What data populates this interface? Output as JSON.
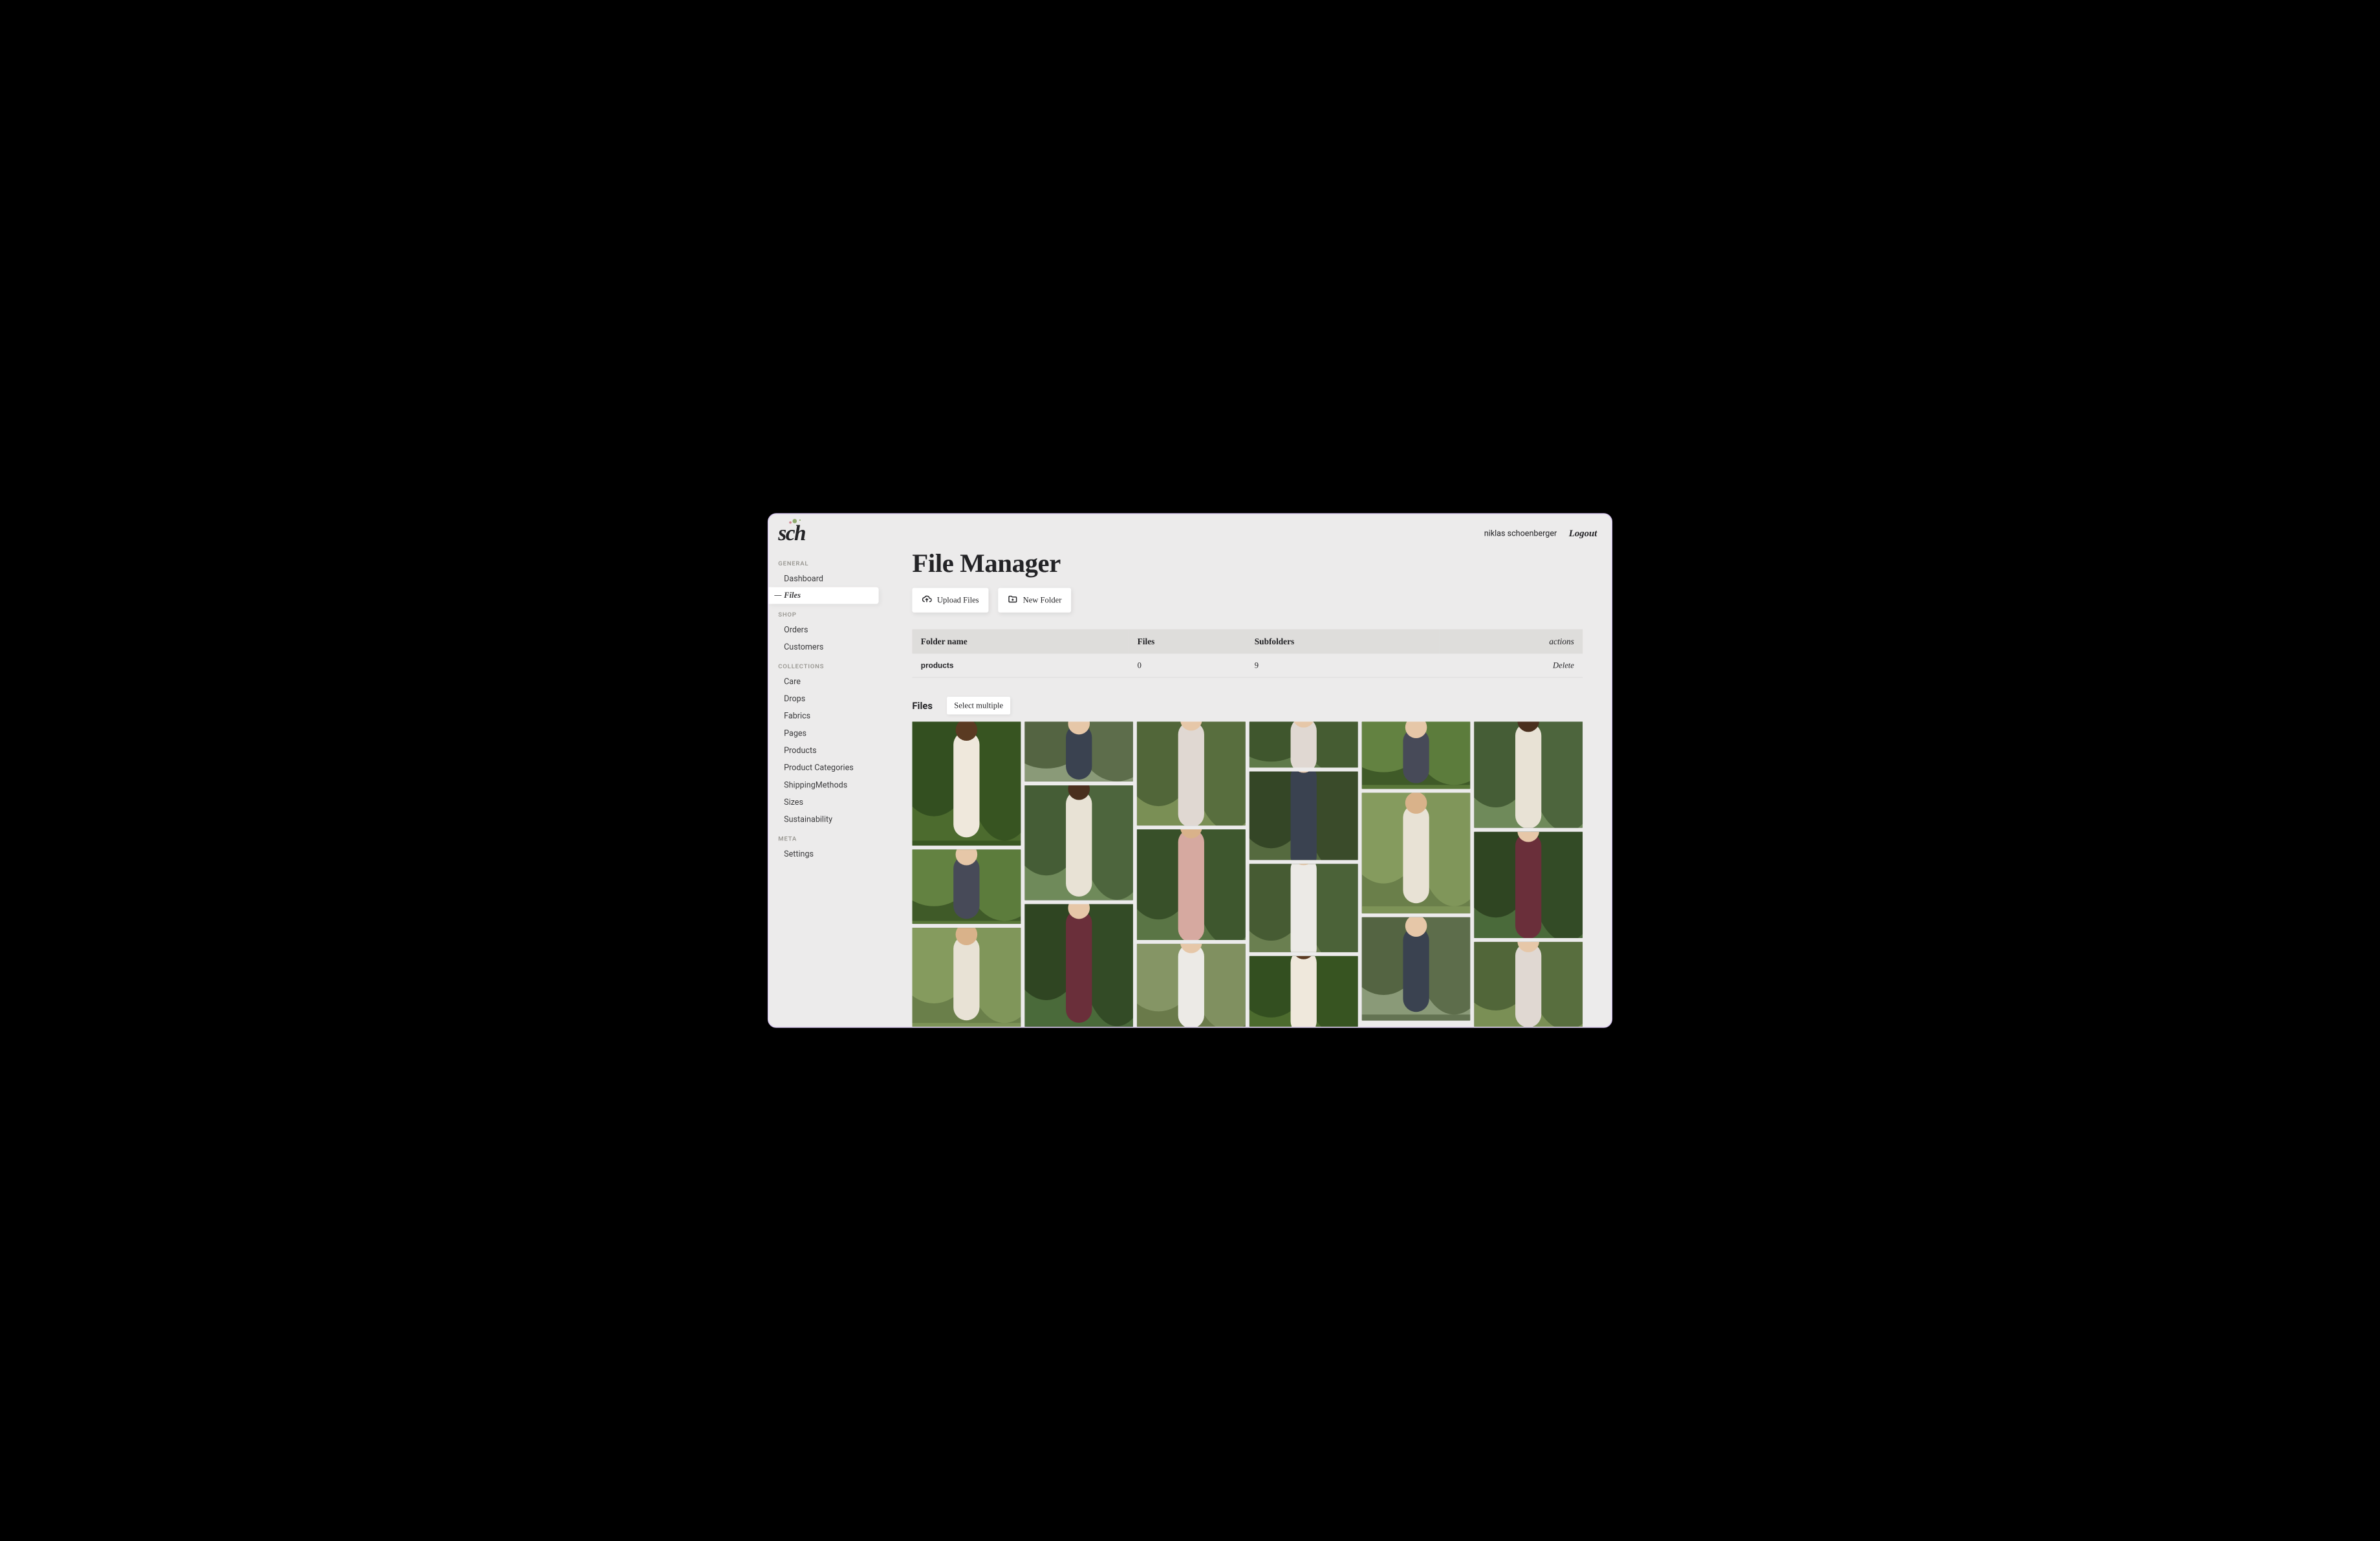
{
  "brand": "sch",
  "user": {
    "name": "niklas schoenberger",
    "logout": "Logout"
  },
  "sidebar": {
    "groups": [
      {
        "label": "GENERAL",
        "items": [
          "Dashboard",
          "Files"
        ]
      },
      {
        "label": "SHOP",
        "items": [
          "Orders",
          "Customers"
        ]
      },
      {
        "label": "COLLECTIONS",
        "items": [
          "Care",
          "Drops",
          "Fabrics",
          "Pages",
          "Products",
          "Product Categories",
          "ShippingMethods",
          "Sizes",
          "Sustainability"
        ]
      },
      {
        "label": "META",
        "items": [
          "Settings"
        ]
      }
    ],
    "active": "Files"
  },
  "page": {
    "title": "File Manager",
    "upload_btn": "Upload Files",
    "newfolder_btn": "New Folder",
    "table": {
      "headers": {
        "name": "Folder name",
        "files": "Files",
        "subfolders": "Subfolders",
        "actions": "actions"
      },
      "rows": [
        {
          "name": "products",
          "files": "0",
          "subfolders": "9",
          "action": "Delete"
        }
      ]
    },
    "files_label": "Files",
    "select_multiple": "Select multiple"
  }
}
